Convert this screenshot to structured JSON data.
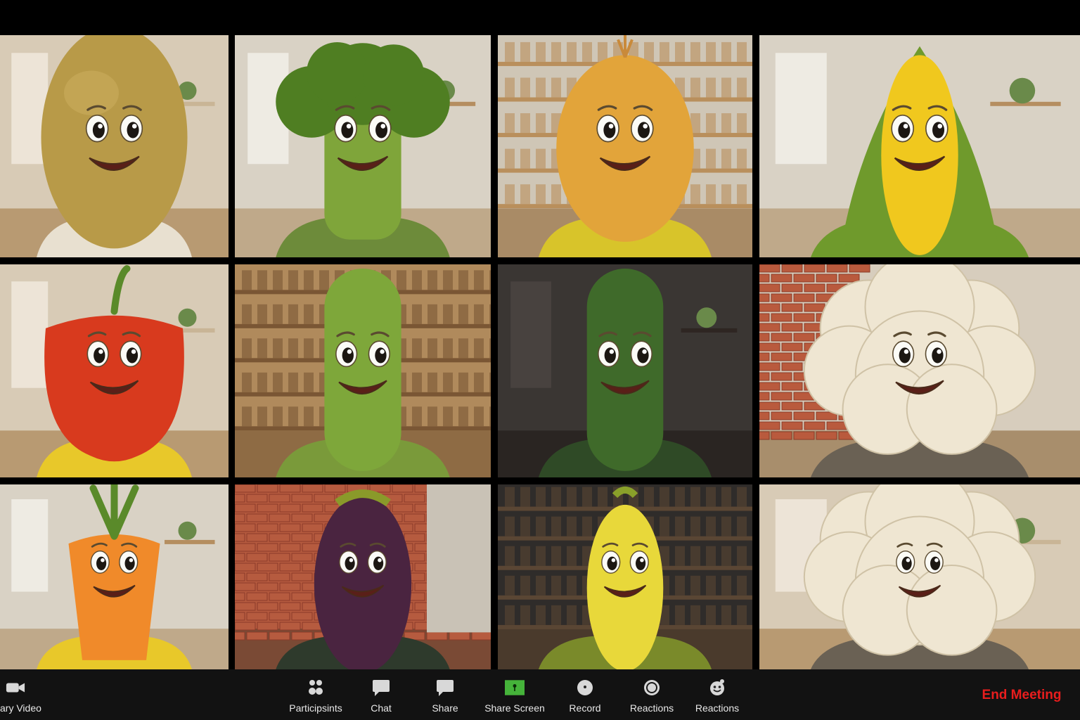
{
  "meeting": {
    "participants": [
      {
        "character": "potato",
        "background": "living-room"
      },
      {
        "character": "broccoli",
        "background": "kitchen"
      },
      {
        "character": "onion",
        "background": "kitchen-shelves"
      },
      {
        "character": "corn",
        "background": "kitchen"
      },
      {
        "character": "red-bell-pepper",
        "background": "living-room"
      },
      {
        "character": "cucumber",
        "background": "bookshelf"
      },
      {
        "character": "zucchini",
        "background": "dark-room"
      },
      {
        "character": "cauliflower",
        "background": "brick-wall-room"
      },
      {
        "character": "carrot",
        "background": "kitchen"
      },
      {
        "character": "eggplant",
        "background": "brick-wall"
      },
      {
        "character": "yellow-squash",
        "background": "dark-shelves"
      },
      {
        "character": "cauliflower",
        "background": "living-room"
      }
    ]
  },
  "toolbar": {
    "buttons": [
      {
        "name": "video-button",
        "label": "ary Video",
        "icon": "video-camera-icon"
      },
      {
        "name": "participants-button",
        "label": "Participsints",
        "icon": "participants-icon"
      },
      {
        "name": "chat-button",
        "label": "Chat",
        "icon": "chat-bubble-icon"
      },
      {
        "name": "share-button",
        "label": "Share",
        "icon": "chat-bubble-icon"
      },
      {
        "name": "share-screen-button",
        "label": "Share Screen",
        "icon": "share-screen-icon"
      },
      {
        "name": "record-button",
        "label": "Record",
        "icon": "record-icon"
      },
      {
        "name": "reactions-button",
        "label": "Reactions",
        "icon": "record-ring-icon"
      },
      {
        "name": "reactions-emoji-button",
        "label": "Reactions",
        "icon": "reaction-emoji-icon"
      }
    ],
    "end_meeting_label": "End Meeting"
  },
  "colors": {
    "toolbar_bg": "#121212",
    "end_meeting": "#e81d1d",
    "share_screen_icon": "#45b33a"
  }
}
